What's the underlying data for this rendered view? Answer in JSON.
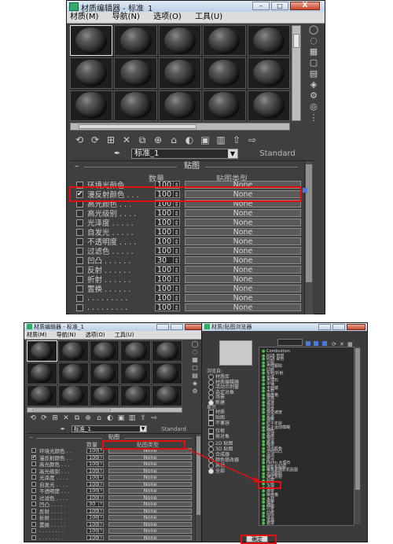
{
  "top_editor": {
    "title": "材质编辑器 - 标准_1",
    "menus": [
      "材质(M)",
      "导航(N)",
      "选项(O)",
      "工具(U)"
    ],
    "window_buttons": {
      "minimize": "–",
      "maximize": "□",
      "close": "X"
    },
    "material_name": "标准_1",
    "material_type": "Standard",
    "maps_rollout_title": "贴图",
    "col_amount": "数量",
    "col_map_type": "贴图类型",
    "maps": [
      {
        "label": "环境光颜色 . . .",
        "amount": "100",
        "map": "None",
        "checked": false
      },
      {
        "label": "漫反射颜色 . . .",
        "amount": "100",
        "map": "None",
        "checked": true
      },
      {
        "label": "高光颜色 . . .",
        "amount": "100",
        "map": "None",
        "checked": false
      },
      {
        "label": "高光级别 . . . .",
        "amount": "100",
        "map": "None",
        "checked": false
      },
      {
        "label": "光泽度 . . . . .",
        "amount": "100",
        "map": "None",
        "checked": false
      },
      {
        "label": "自发光 . . . . .",
        "amount": "100",
        "map": "None",
        "checked": false
      },
      {
        "label": "不透明度 . . . .",
        "amount": "100",
        "map": "None",
        "checked": false
      },
      {
        "label": "过滤色 . . . . .",
        "amount": "100",
        "map": "None",
        "checked": false
      },
      {
        "label": "凹凸 . . . . . .",
        "amount": "30",
        "map": "None",
        "checked": false
      },
      {
        "label": "反射 . . . . . .",
        "amount": "100",
        "map": "None",
        "checked": false
      },
      {
        "label": "折射 . . . . . .",
        "amount": "100",
        "map": "None",
        "checked": false
      },
      {
        "label": "置换 . . . . . .",
        "amount": "100",
        "map": "None",
        "checked": false
      },
      {
        "label": ". . . . . . . . .",
        "amount": "100",
        "map": "None",
        "checked": false
      },
      {
        "label": ". . . . . . . . .",
        "amount": "100",
        "map": "None",
        "checked": false
      }
    ]
  },
  "bottom_editor": {
    "title": "材质编辑器 - 标准_1",
    "menus": [
      "材质(M)",
      "导航(N)",
      "选项(O)",
      "工具(U)"
    ],
    "material_name": "标准_1",
    "material_type": "Standard",
    "maps_rollout_title": "贴图",
    "col_amount": "数量",
    "col_map_type": "贴图类型",
    "maps": [
      {
        "label": "环境光颜色 . .",
        "amount": "100",
        "map": "None",
        "checked": false
      },
      {
        "label": "漫反射颜色 . .",
        "amount": "100",
        "map": "None",
        "checked": true
      },
      {
        "label": "高光颜色 . . .",
        "amount": "100",
        "map": "None",
        "checked": false
      },
      {
        "label": "高光级别 . . .",
        "amount": "100",
        "map": "None",
        "checked": false
      },
      {
        "label": "光泽度 . . . .",
        "amount": "100",
        "map": "None",
        "checked": false
      },
      {
        "label": "自发光 . . . .",
        "amount": "100",
        "map": "None",
        "checked": false
      },
      {
        "label": "不透明度 . . .",
        "amount": "100",
        "map": "None",
        "checked": false
      },
      {
        "label": "过滤色 . . . .",
        "amount": "100",
        "map": "None",
        "checked": false
      },
      {
        "label": "凹凸 . . . . .",
        "amount": "30",
        "map": "None",
        "checked": false
      },
      {
        "label": "反射 . . . . .",
        "amount": "100",
        "map": "None",
        "checked": false
      },
      {
        "label": "折射 . . . . .",
        "amount": "100",
        "map": "None",
        "checked": false
      },
      {
        "label": "置换 . . . . .",
        "amount": "100",
        "map": "None",
        "checked": false
      },
      {
        "label": ". . . . . . . .",
        "amount": "100",
        "map": "None",
        "checked": false
      },
      {
        "label": ". . . . . . . .",
        "amount": "100",
        "map": "None",
        "checked": false
      }
    ]
  },
  "browser": {
    "title": "材质/贴图浏览器",
    "window_buttons": {
      "minimize": "–",
      "maximize": "□",
      "close": "X"
    },
    "browse_from_title": "浏览自:",
    "browse_from": [
      {
        "label": "材质库",
        "on": false
      },
      {
        "label": "材质编辑器",
        "on": false
      },
      {
        "label": "活动示例窗",
        "on": false
      },
      {
        "label": "选定对象",
        "on": false
      },
      {
        "label": "场景",
        "on": false
      },
      {
        "label": "新建",
        "on": true
      }
    ],
    "show_title": "显示",
    "show": [
      "材质",
      "贴图",
      "不兼容"
    ],
    "root_options": [
      "仅根",
      "按对象"
    ],
    "categories": [
      {
        "label": "2D 贴图",
        "on": false
      },
      {
        "label": "3D 贴图",
        "on": false
      },
      {
        "label": "合成器",
        "on": false
      },
      {
        "label": "颜色修改器",
        "on": false
      },
      {
        "label": "其他",
        "on": false
      },
      {
        "label": "全部",
        "on": true
      }
    ],
    "items": [
      "Combustion",
      "RGB 倍增",
      "RGB 染色",
      "位图",
      "光线跟踪",
      "凹痕",
      "反射/折射",
      "合成",
      "大理石",
      "平铺",
      "平面镜",
      "木材",
      "棋盘格",
      "泼溅",
      "波浪",
      "混合",
      "渐变",
      "渐变坡度",
      "灰泥",
      "烟雾",
      "粒子年龄",
      "粒子运动模糊",
      "细胞",
      "衰减",
      "输出",
      "遮罩",
      "噪波",
      "顶点颜色",
      "法线凹凸",
      "漩涡",
      "斑点",
      "Perlin 大理石",
      "摄影机贴图",
      "每像素摄影机贴图",
      "光线跟踪",
      "薄壁折射",
      "贴图",
      "位图",
      "合成",
      "渐变",
      "棋盘格",
      "木材",
      "烟雾",
      "细胞",
      "行星",
      "凹痕",
      "混合",
      "泼溅",
      "遮罩"
    ],
    "ok_label": "确定"
  }
}
